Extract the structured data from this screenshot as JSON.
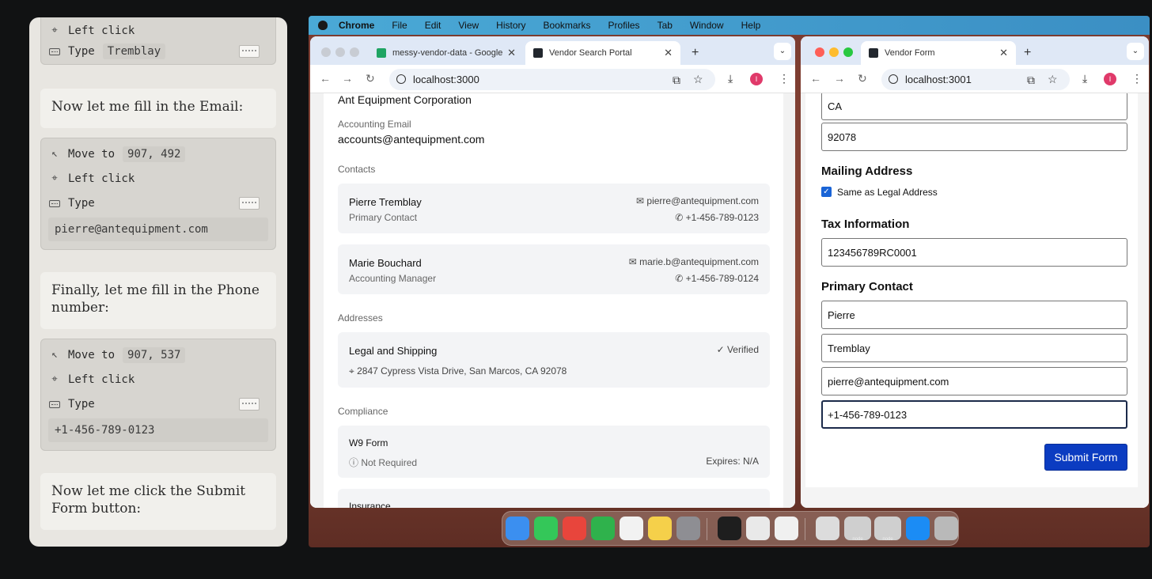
{
  "agent_panel": {
    "step1": {
      "click_label": "Left click",
      "type_label": "Type",
      "typed_value": "Tremblay"
    },
    "msg_email": "Now let me fill in the Email:",
    "step2": {
      "move_label": "Move to",
      "move_coords": "907, 492",
      "click_label": "Left click",
      "type_label": "Type",
      "typed_value": "pierre@antequipment.com"
    },
    "msg_phone": "Finally, let me fill in the Phone number:",
    "step3": {
      "move_label": "Move to",
      "move_coords": "907, 537",
      "click_label": "Left click",
      "type_label": "Type",
      "typed_value": "+1-456-789-0123"
    },
    "msg_submit": "Now let me click the Submit Form button:"
  },
  "menubar": {
    "app": "Chrome",
    "items": [
      "File",
      "Edit",
      "View",
      "History",
      "Bookmarks",
      "Profiles",
      "Tab",
      "Window",
      "Help"
    ]
  },
  "window_left": {
    "tabs": [
      {
        "title": "messy-vendor-data - Google",
        "favicon_color": "#1fa463"
      },
      {
        "title": "Vendor Search Portal",
        "favicon_color": "#22272e"
      }
    ],
    "url": "localhost:3000",
    "profile_initial": "I",
    "page": {
      "company": "Ant Equipment Corporation",
      "accounting_email_label": "Accounting Email",
      "accounting_email": "accounts@antequipment.com",
      "contacts_heading": "Contacts",
      "contacts": [
        {
          "name": "Pierre Tremblay",
          "role": "Primary Contact",
          "email": "pierre@antequipment.com",
          "phone": "+1-456-789-0123"
        },
        {
          "name": "Marie Bouchard",
          "role": "Accounting Manager",
          "email": "marie.b@antequipment.com",
          "phone": "+1-456-789-0124"
        }
      ],
      "addresses_heading": "Addresses",
      "address": {
        "title": "Legal and Shipping",
        "status": "Verified",
        "line": "2847 Cypress Vista Drive, San Marcos, CA 92078"
      },
      "compliance_heading": "Compliance",
      "compliance": [
        {
          "title": "W9 Form",
          "status": "Not Required",
          "expires": "Expires: N/A"
        },
        {
          "title": "Insurance"
        }
      ]
    }
  },
  "window_right": {
    "tab_title": "Vendor Form",
    "url": "localhost:3001",
    "profile_initial": "I",
    "form": {
      "state": "CA",
      "zip": "92078",
      "mailing_heading": "Mailing Address",
      "same_as_legal_label": "Same as Legal Address",
      "same_as_legal_checked": true,
      "tax_heading": "Tax Information",
      "tax_id": "123456789RC0001",
      "primary_heading": "Primary Contact",
      "first_name": "Pierre",
      "last_name": "Tremblay",
      "email": "pierre@antequipment.com",
      "phone": "+1-456-789-0123",
      "submit_label": "Submit Form"
    }
  },
  "dock": {
    "icons": [
      {
        "name": "finder-icon",
        "color": "#3b8ff0"
      },
      {
        "name": "messages-icon",
        "color": "#34c759"
      },
      {
        "name": "chrome-icon",
        "color": "#e8453c"
      },
      {
        "name": "facetime-icon",
        "color": "#2fb24c"
      },
      {
        "name": "reminders-icon",
        "color": "#f2f2f2"
      },
      {
        "name": "notes-icon",
        "color": "#f5d04a"
      },
      {
        "name": "settings-icon",
        "color": "#8e8e93"
      },
      {
        "name": "terminal-icon",
        "color": "#1e1e1e"
      },
      {
        "name": "document-icon",
        "color": "#e9e9e9"
      },
      {
        "name": "textedit-icon",
        "color": "#f0f0f0"
      },
      {
        "name": "file-icon",
        "color": "#dcdcdc"
      },
      {
        "name": "node-window-icon",
        "color": "#cfcfcf"
      },
      {
        "name": "node-window-icon-2",
        "color": "#cfcfcf"
      },
      {
        "name": "app-store-icon",
        "color": "#1b8cf5"
      },
      {
        "name": "trash-icon",
        "color": "#b9b9b9"
      }
    ],
    "thumb_label": "node"
  }
}
